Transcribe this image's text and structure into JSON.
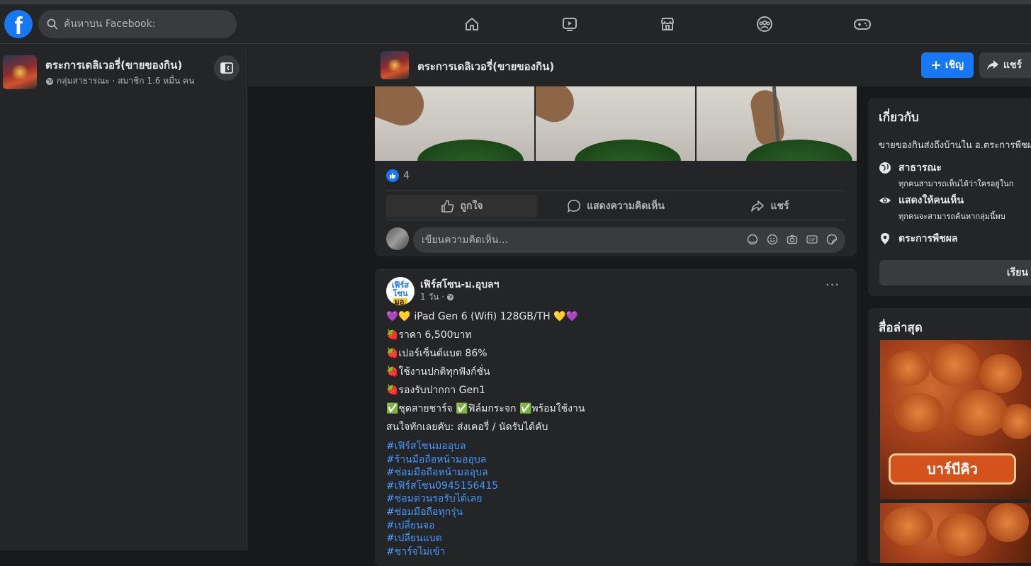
{
  "topbar": {
    "search_placeholder": "ค้นหาบน Facebook:",
    "nav_icons": [
      "home-icon",
      "watch-icon",
      "marketplace-icon",
      "groups-icon",
      "gaming-icon"
    ]
  },
  "left_panel": {
    "group_title": "ตระการเดลิเวอรี่(ขายของกิน)",
    "group_meta": "กลุ่มสาธารณะ · สมาชิก 1.6 หมื่น คน"
  },
  "group_bar": {
    "title": "ตระการเดลิเวอรี่(ขายของกิน)",
    "invite_label": "เชิญ",
    "share_label": "แชร์"
  },
  "post1": {
    "reaction_count": "4",
    "actions": {
      "like": "ถูกใจ",
      "comment": "แสดงความคิดเห็น",
      "share": "แชร์"
    },
    "comment_placeholder": "เขียนความคิดเห็น..."
  },
  "post2": {
    "author": "เฟิร์สโซน-ม.อุบลฯ",
    "time": "1 วัน ·",
    "lines": [
      "💜💛 iPad Gen 6 (Wifi)  128GB/TH 💛💜",
      "🍓ราคา 6,500บาท",
      "🍓เปอร์เซ็นต์แบต 86%",
      "🍓ใช้งานปกติทุกฟังก์ชั่น",
      "🍓รองรับปากกา Gen1",
      "✅ชุดสายชาร์จ ✅ฟิล์มกระจก  ✅พร้อมใช้งาน",
      "สนใจทักเลยคับ: ส่งเคอรี่ / นัดรับได้คับ"
    ],
    "hashtags": [
      "#เฟิร์สโซนมออุบล",
      "#ร้านมือถือหน้ามออุบล",
      "#ซ่อมมือถือหน้ามออุบล",
      "#เฟิร์สโซน0945156415",
      "#ซ่อมด่วนรอรับได้เลย",
      "#ซ่อมมือถือทุกรุ่น",
      "#เปลี่ยนจอ",
      "#เปลี่ยนแบต",
      "#ชาร์จไม่เข้า"
    ]
  },
  "about": {
    "heading": "เกี่ยวกับ",
    "description": "ขายของกินส่งถึงบ้านใน อ.ตระการพืชผ",
    "public_title": "สาธารณะ",
    "public_desc": "ทุกคนสามารถเห็นได้ว่าใครอยู่ในก",
    "visible_title": "แสดงให้คนเห็น",
    "visible_desc": "ทุกคนจะสามารถค้นหากลุ่มนี้พบ",
    "location": "ตระการพืชผล",
    "learn_more": "เรียน"
  },
  "media": {
    "heading": "สื่อล่าสุด",
    "label": "บาร์บีคิว"
  },
  "colors": {
    "accent": "#1877f2",
    "link": "#4599ff",
    "card": "#242526",
    "background": "#18191a"
  }
}
